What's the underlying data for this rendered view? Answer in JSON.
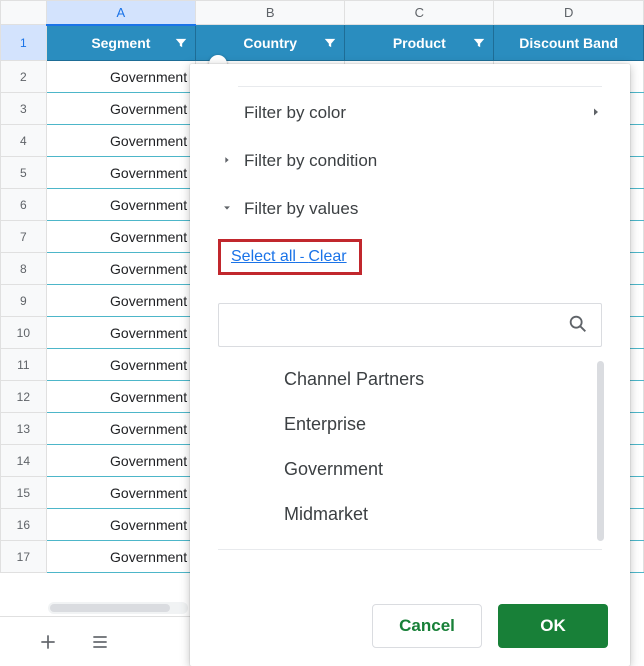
{
  "columns": {
    "A": "Segment",
    "B": "Country",
    "C": "Product",
    "D": "Discount Band"
  },
  "row_label": "Government",
  "row_count": 16,
  "filter": {
    "by_color": "Filter by color",
    "by_condition": "Filter by condition",
    "by_values": "Filter by values",
    "select_all": "Select all",
    "clear": "Clear",
    "search_placeholder": "",
    "values": [
      "Channel Partners",
      "Enterprise",
      "Government",
      "Midmarket"
    ],
    "cancel": "Cancel",
    "ok": "OK"
  }
}
